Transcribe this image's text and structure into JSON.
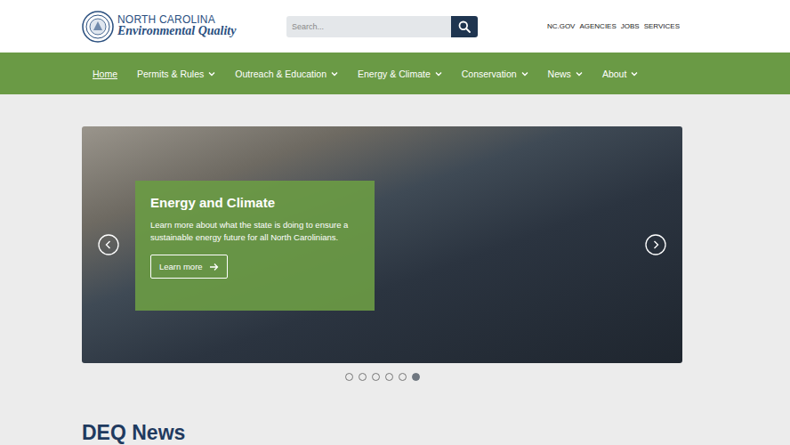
{
  "header": {
    "logo": {
      "line1": "NORTH CAROLINA",
      "line2": "Environmental Quality"
    },
    "search": {
      "placeholder": "Search..."
    },
    "utility_links": [
      "NC.GOV",
      "AGENCIES",
      "JOBS",
      "SERVICES"
    ]
  },
  "nav": [
    {
      "label": "Home",
      "selected": true,
      "has_menu": false
    },
    {
      "label": "Permits & Rules",
      "selected": false,
      "has_menu": true
    },
    {
      "label": "Outreach & Education",
      "selected": false,
      "has_menu": true
    },
    {
      "label": "Energy & Climate",
      "selected": false,
      "has_menu": true
    },
    {
      "label": "Conservation",
      "selected": false,
      "has_menu": true
    },
    {
      "label": "News",
      "selected": false,
      "has_menu": true
    },
    {
      "label": "About",
      "selected": false,
      "has_menu": true
    }
  ],
  "hero": {
    "title": "Energy and Climate",
    "body": "Learn more about what the state is doing to ensure a sustainable energy future for all North Carolinians.",
    "button": "Learn more",
    "slides": [
      {
        "selected": false
      },
      {
        "selected": false
      },
      {
        "selected": false
      },
      {
        "selected": false
      },
      {
        "selected": false
      },
      {
        "selected": true
      }
    ]
  },
  "news": {
    "heading": "DEQ News"
  }
}
